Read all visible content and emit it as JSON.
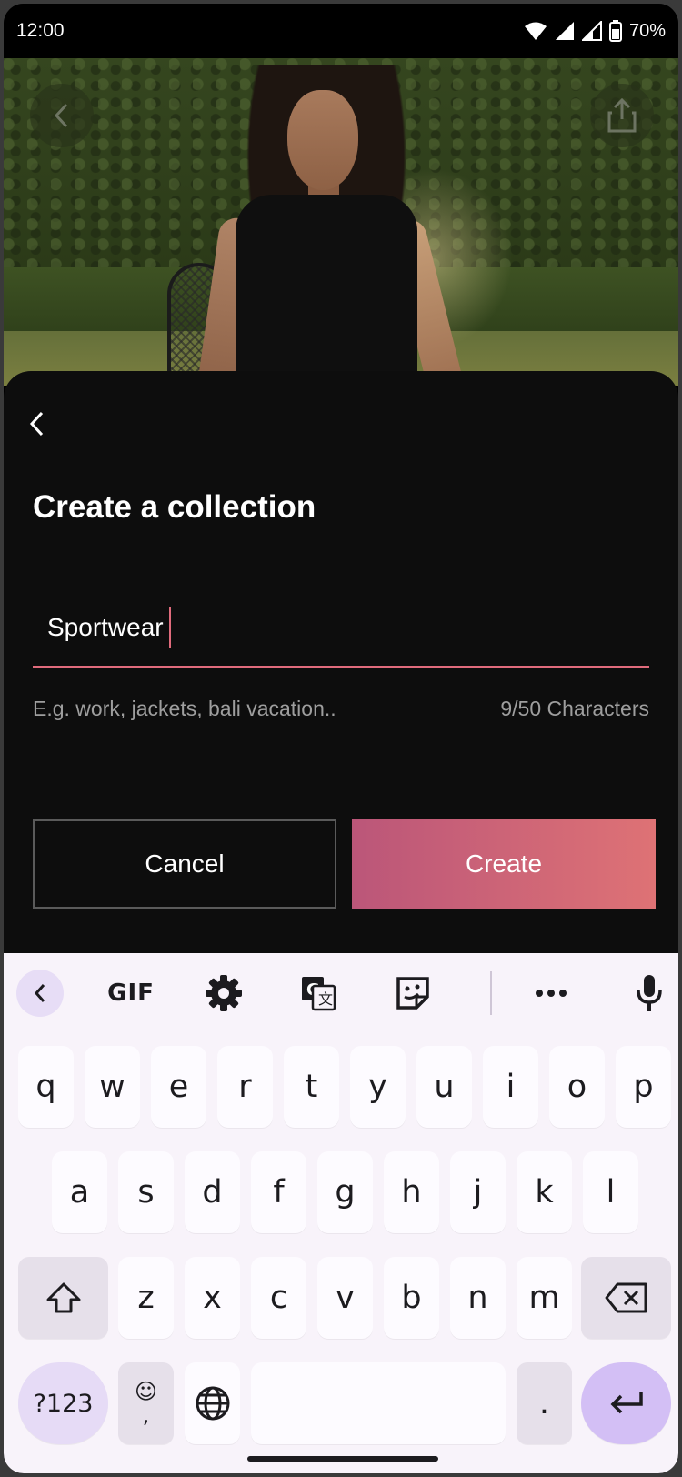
{
  "status_bar": {
    "time": "12:00",
    "battery": "70%"
  },
  "hero": {
    "alt": "model in black sleeveless dress on a tennis lawn"
  },
  "sheet": {
    "title": "Create a collection",
    "input_value": "Sportwear",
    "hint": "E.g. work, jackets, bali vacation..",
    "counter": "9/50 Characters",
    "cancel_label": "Cancel",
    "create_label": "Create",
    "accent_color": "#e06b7c"
  },
  "keyboard": {
    "toolbar": {
      "gif_label": "GIF"
    },
    "row1": [
      "q",
      "w",
      "e",
      "r",
      "t",
      "y",
      "u",
      "i",
      "o",
      "p"
    ],
    "row2": [
      "a",
      "s",
      "d",
      "f",
      "g",
      "h",
      "j",
      "k",
      "l"
    ],
    "row3": [
      "z",
      "x",
      "c",
      "v",
      "b",
      "n",
      "m"
    ],
    "symbols_label": "?123",
    "emoji_comma_top": "☺",
    "emoji_comma_bottom": ",",
    "period_label": "."
  }
}
